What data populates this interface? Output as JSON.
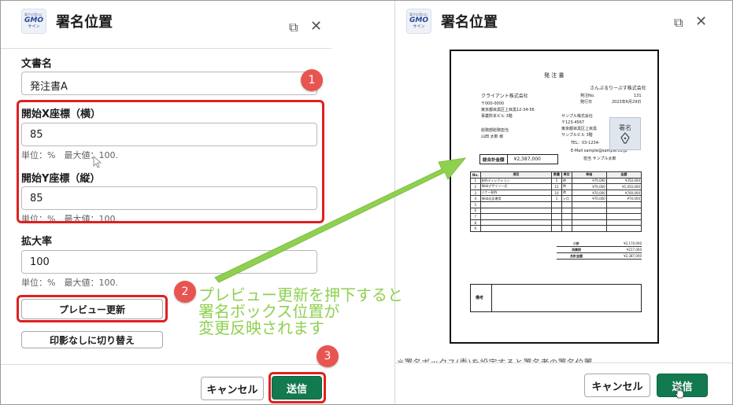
{
  "left": {
    "title": "署名位置",
    "logo_lines": [
      "電子の窓口に",
      "GMO",
      "サイン"
    ],
    "doc_name_label": "文書名",
    "doc_name_value": "発注書A",
    "x_label": "開始X座標（横）",
    "x_value": "85",
    "x_hint": "単位：%　最大値：100.",
    "y_label": "開始Y座標（縦）",
    "y_value": "85",
    "y_hint": "単位：%　最大値：100.",
    "scale_label": "拡大率",
    "scale_value": "100",
    "scale_hint": "単位：%　最大値：100.",
    "preview_button": "プレビュー更新",
    "no_stamp_button": "印影なしに切り替え",
    "cancel_button": "キャンセル",
    "send_button": "送信"
  },
  "right": {
    "title": "署名位置",
    "cancel_button": "キャンセル",
    "send_button": "送信",
    "below_text": "※署名ボックス(青)を設定すると署名者の署名位置"
  },
  "badges": [
    "1",
    "2",
    "3"
  ],
  "annotation": [
    "プレビュー更新を押下すると",
    "署名ボックス位置が",
    "変更反映されます"
  ],
  "document": {
    "title": "発 注 書",
    "recipient_company": "さんぷるりーぶす株式会社",
    "order_no_label": "発注No.",
    "order_no": "131",
    "order_date_label": "発行日",
    "order_date": "2023年6月29日",
    "client_company": "クライアント株式会社",
    "client_zip": "〒000-0000",
    "client_addr": "東京都目黒区上目黒12-34-56",
    "client_bldg": "事業所本ビル 3階",
    "client_person1": "総務部総務担当",
    "client_person2": "山田 太郎 様",
    "vendor_company": "サンプル株式会社",
    "vendor_zip": "〒123-4567",
    "vendor_addr": "東京都目黒区上目黒",
    "vendor_bldg": "サンプルビル 3階",
    "vendor_tel": "TEL：03-1234-",
    "vendor_mail": "E-Mail  sample@sample.co.jp",
    "vendor_person": "担当 サンプル太郎",
    "stamp_label": "署名",
    "total_label": "総合計金額",
    "total_value": "¥2,387,000",
    "columns": [
      "No.",
      "項目",
      "数量",
      "単位",
      "単価",
      "金額"
    ],
    "rows": [
      [
        "1",
        "制作ディレクション",
        "5",
        "時",
        "¥70,000",
        "¥350,000"
      ],
      [
        "2",
        "Webデザイン一式",
        "15",
        "時",
        "¥70,000",
        "¥1,050,000"
      ],
      [
        "3",
        "バナー制作",
        "10",
        "時",
        "¥70,000",
        "¥700,000"
      ],
      [
        "4",
        "Web広告運用",
        "1",
        "ヶ月",
        "¥70,000",
        "¥70,000"
      ],
      [
        "5",
        "",
        "",
        "",
        "",
        ""
      ],
      [
        "6",
        "",
        "",
        "",
        "",
        ""
      ],
      [
        "7",
        "",
        "",
        "",
        "",
        ""
      ],
      [
        "8",
        "",
        "",
        "",
        "",
        ""
      ],
      [
        "9",
        "",
        "",
        "",
        "",
        ""
      ]
    ],
    "subtotal_label": "小計",
    "subtotal_value": "¥2,170,000",
    "tax_label": "消費税",
    "tax_value": "¥217,000",
    "grand_label": "合計金額",
    "grand_value": "¥2,387,000",
    "remarks_label": "備考"
  },
  "colors": {
    "green": "#137a4f",
    "red": "#e02020",
    "badge": "#e85550",
    "annotation": "#8fd050"
  }
}
